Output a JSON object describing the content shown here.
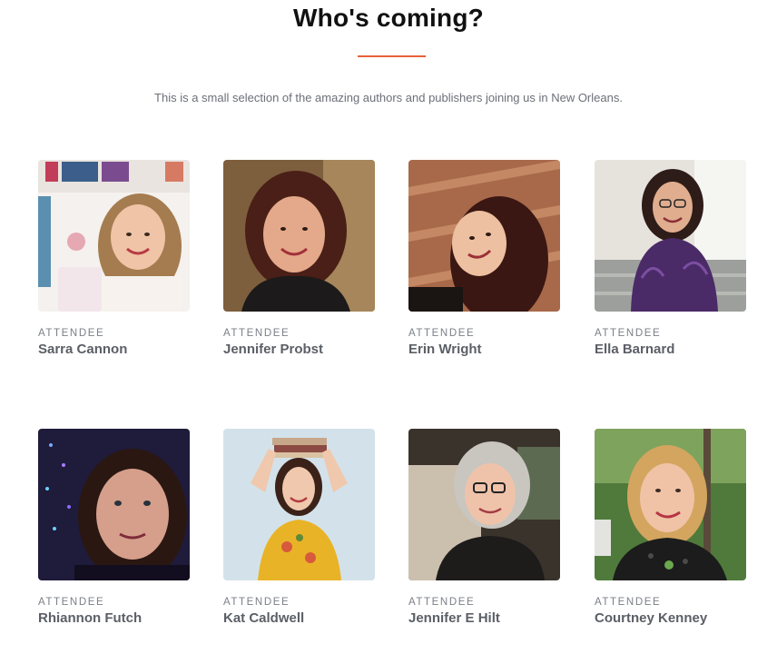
{
  "section": {
    "title": "Who's coming?",
    "subtitle": "This is a small selection of the amazing authors and publishers joining us in New Orleans.",
    "accent_color": "#e8613a"
  },
  "attendees": [
    {
      "role": "ATTENDEE",
      "name": "Sarra Cannon"
    },
    {
      "role": "ATTENDEE",
      "name": "Jennifer Probst"
    },
    {
      "role": "ATTENDEE",
      "name": "Erin Wright"
    },
    {
      "role": "ATTENDEE",
      "name": "Ella Barnard"
    },
    {
      "role": "ATTENDEE",
      "name": "Rhiannon Futch"
    },
    {
      "role": "ATTENDEE",
      "name": "Kat Caldwell"
    },
    {
      "role": "ATTENDEE",
      "name": "Jennifer E Hilt"
    },
    {
      "role": "ATTENDEE",
      "name": "Courtney Kenney"
    }
  ]
}
